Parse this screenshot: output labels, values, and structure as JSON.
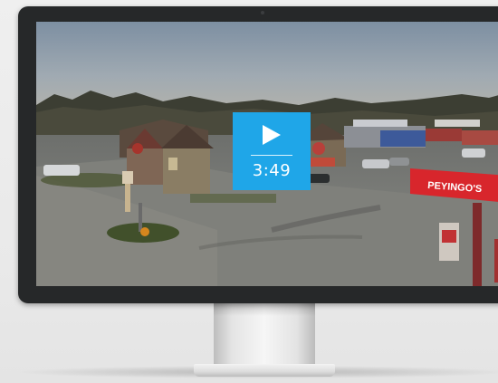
{
  "video": {
    "duration": "3:49",
    "play_icon": "play-icon",
    "accent_color": "#1fa6e8"
  },
  "scene": {
    "store_sign": "PEYINGO'S"
  },
  "monitor": {
    "bezel_color": "#262829"
  }
}
